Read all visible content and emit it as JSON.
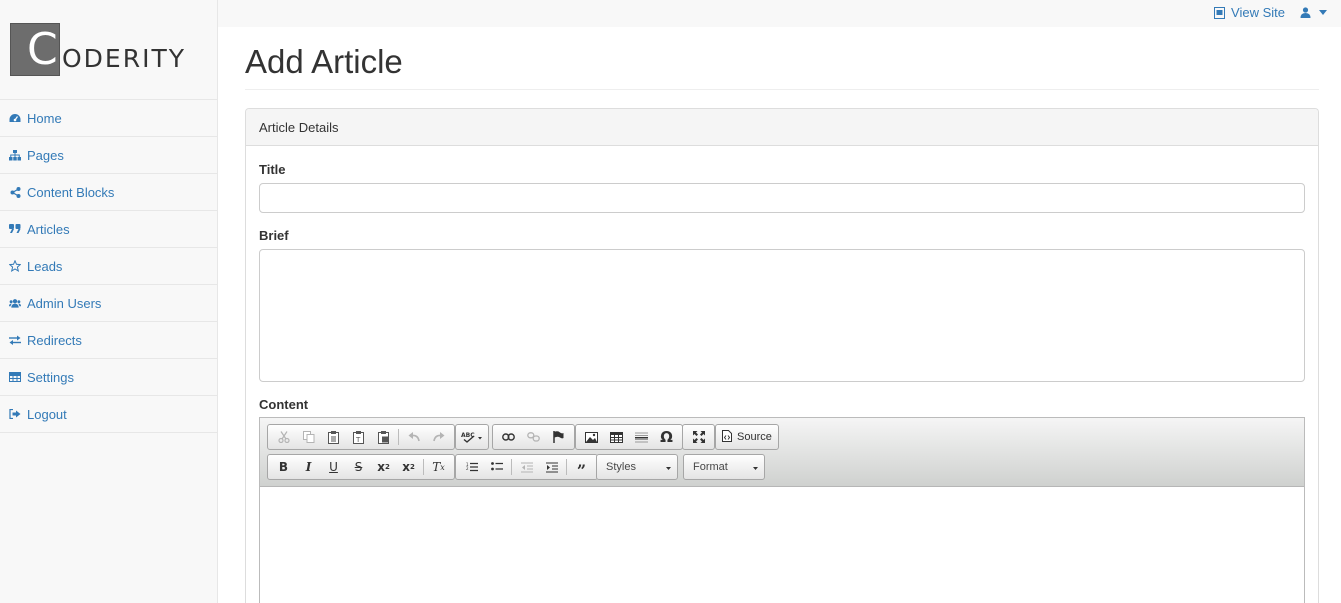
{
  "topnav": {
    "view_site": "View Site",
    "user_icon": "user-icon"
  },
  "brand": {
    "first_letter": "C",
    "rest": "ODERITY"
  },
  "sidebar": {
    "items": [
      {
        "label": "Home",
        "icon": "dashboard-icon"
      },
      {
        "label": "Pages",
        "icon": "sitemap-icon"
      },
      {
        "label": "Content Blocks",
        "icon": "share-icon"
      },
      {
        "label": "Articles",
        "icon": "quote-icon"
      },
      {
        "label": "Leads",
        "icon": "star-icon"
      },
      {
        "label": "Admin Users",
        "icon": "users-icon"
      },
      {
        "label": "Redirects",
        "icon": "exchange-icon"
      },
      {
        "label": "Settings",
        "icon": "table-icon"
      },
      {
        "label": "Logout",
        "icon": "sign-out-icon"
      }
    ]
  },
  "page": {
    "title": "Add Article"
  },
  "panel": {
    "heading": "Article Details",
    "title_label": "Title",
    "title_value": "",
    "brief_label": "Brief",
    "brief_value": "",
    "content_label": "Content"
  },
  "editor": {
    "source_label": "Source",
    "styles_label": "Styles",
    "format_label": "Format",
    "icons_row1": [
      "cut-icon",
      "copy-icon",
      "paste-icon",
      "paste-text-icon",
      "paste-word-icon",
      "undo-icon",
      "redo-icon",
      "spellcheck-icon",
      "link-icon",
      "unlink-icon",
      "anchor-icon",
      "image-icon",
      "table-icon",
      "horizontal-rule-icon",
      "special-char-icon",
      "maximize-icon",
      "source-icon"
    ],
    "icons_row2": [
      "bold-icon",
      "italic-icon",
      "underline-icon",
      "strike-icon",
      "subscript-icon",
      "superscript-icon",
      "remove-format-icon",
      "numbered-list-icon",
      "bulleted-list-icon",
      "outdent-icon",
      "indent-icon",
      "blockquote-icon"
    ]
  }
}
